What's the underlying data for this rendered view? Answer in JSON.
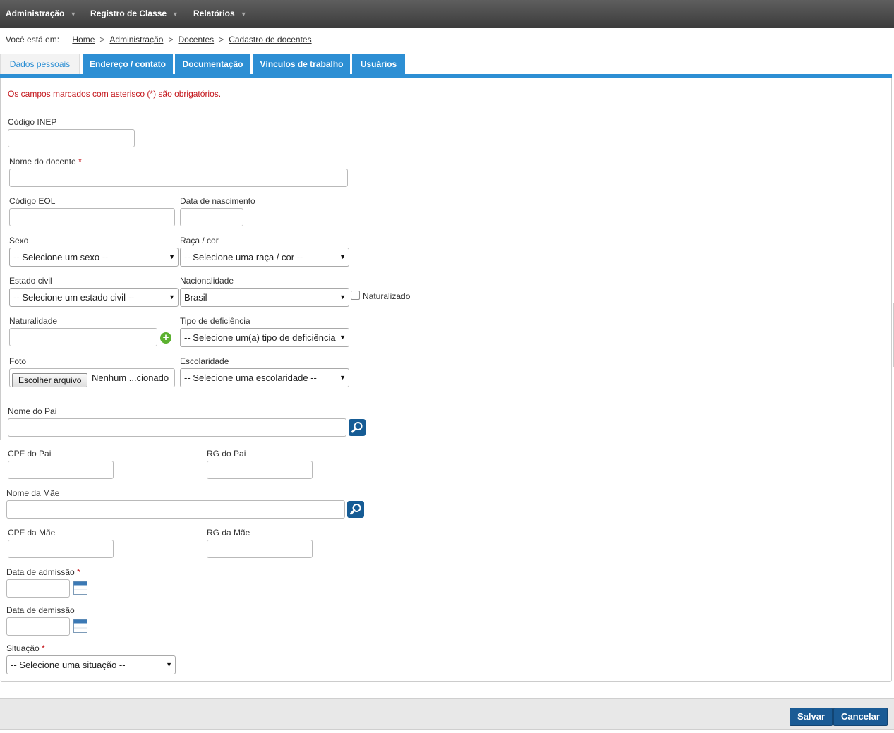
{
  "menu": {
    "items": [
      {
        "label": "Administração"
      },
      {
        "label": "Registro de Classe"
      },
      {
        "label": "Relatórios"
      }
    ]
  },
  "breadcrumb": {
    "lead": "Você está em:",
    "items": [
      "Home",
      "Administração",
      "Docentes",
      "Cadastro de docentes"
    ],
    "separator": ">"
  },
  "tabs": [
    {
      "label": "Dados pessoais",
      "active": true
    },
    {
      "label": "Endereço / contato"
    },
    {
      "label": "Documentação"
    },
    {
      "label": "Vínculos de trabalho"
    },
    {
      "label": "Usuários"
    }
  ],
  "form": {
    "notice": "Os campos marcados com asterisco (*) são obrigatórios.",
    "required_mark": "*",
    "codigo_inep": {
      "label": "Código INEP",
      "value": ""
    },
    "nome_docente": {
      "label": "Nome do docente",
      "value": ""
    },
    "codigo_eol": {
      "label": "Código EOL",
      "value": ""
    },
    "data_nascimento": {
      "label": "Data de nascimento",
      "value": ""
    },
    "sexo": {
      "label": "Sexo",
      "selected": "-- Selecione um sexo --"
    },
    "raca_cor": {
      "label": "Raça / cor",
      "selected": "-- Selecione uma raça / cor --"
    },
    "estado_civil": {
      "label": "Estado civil",
      "selected": "-- Selecione um estado civil --"
    },
    "nacionalidade": {
      "label": "Nacionalidade",
      "selected": "Brasil"
    },
    "naturalizado": {
      "label": "Naturalizado",
      "checked": false
    },
    "naturalidade": {
      "label": "Naturalidade",
      "value": ""
    },
    "tipo_deficiencia": {
      "label": "Tipo de deficiência",
      "selected": "-- Selecione um(a) tipo de deficiência --"
    },
    "foto": {
      "label": "Foto",
      "button": "Escolher arquivo",
      "status": "Nenhum ...cionado"
    },
    "escolaridade": {
      "label": "Escolaridade",
      "selected": "-- Selecione uma escolaridade --"
    },
    "nome_pai": {
      "label": "Nome do Pai",
      "value": ""
    },
    "cpf_pai": {
      "label": "CPF do Pai",
      "value": ""
    },
    "rg_pai": {
      "label": "RG do Pai",
      "value": ""
    },
    "nome_mae": {
      "label": "Nome da Mãe",
      "value": ""
    },
    "cpf_mae": {
      "label": "CPF da Mãe",
      "value": ""
    },
    "rg_mae": {
      "label": "RG da Mãe",
      "value": ""
    },
    "data_admissao": {
      "label": "Data de admissão",
      "value": ""
    },
    "data_demissao": {
      "label": "Data de demissão",
      "value": ""
    },
    "situacao": {
      "label": "Situação",
      "selected": "-- Selecione uma situação --"
    }
  },
  "footer": {
    "save_label": "Salvar",
    "cancel_label": "Cancelar"
  },
  "colors": {
    "tab_blue": "#2d8fd4",
    "required_red": "#c4161c",
    "button_blue": "#1a5b95",
    "add_green": "#5cb130"
  },
  "icons": {
    "dropdown": "caret-down-icon",
    "add": "plus-circle-icon",
    "search": "magnifier-icon",
    "calendar": "calendar-icon"
  }
}
